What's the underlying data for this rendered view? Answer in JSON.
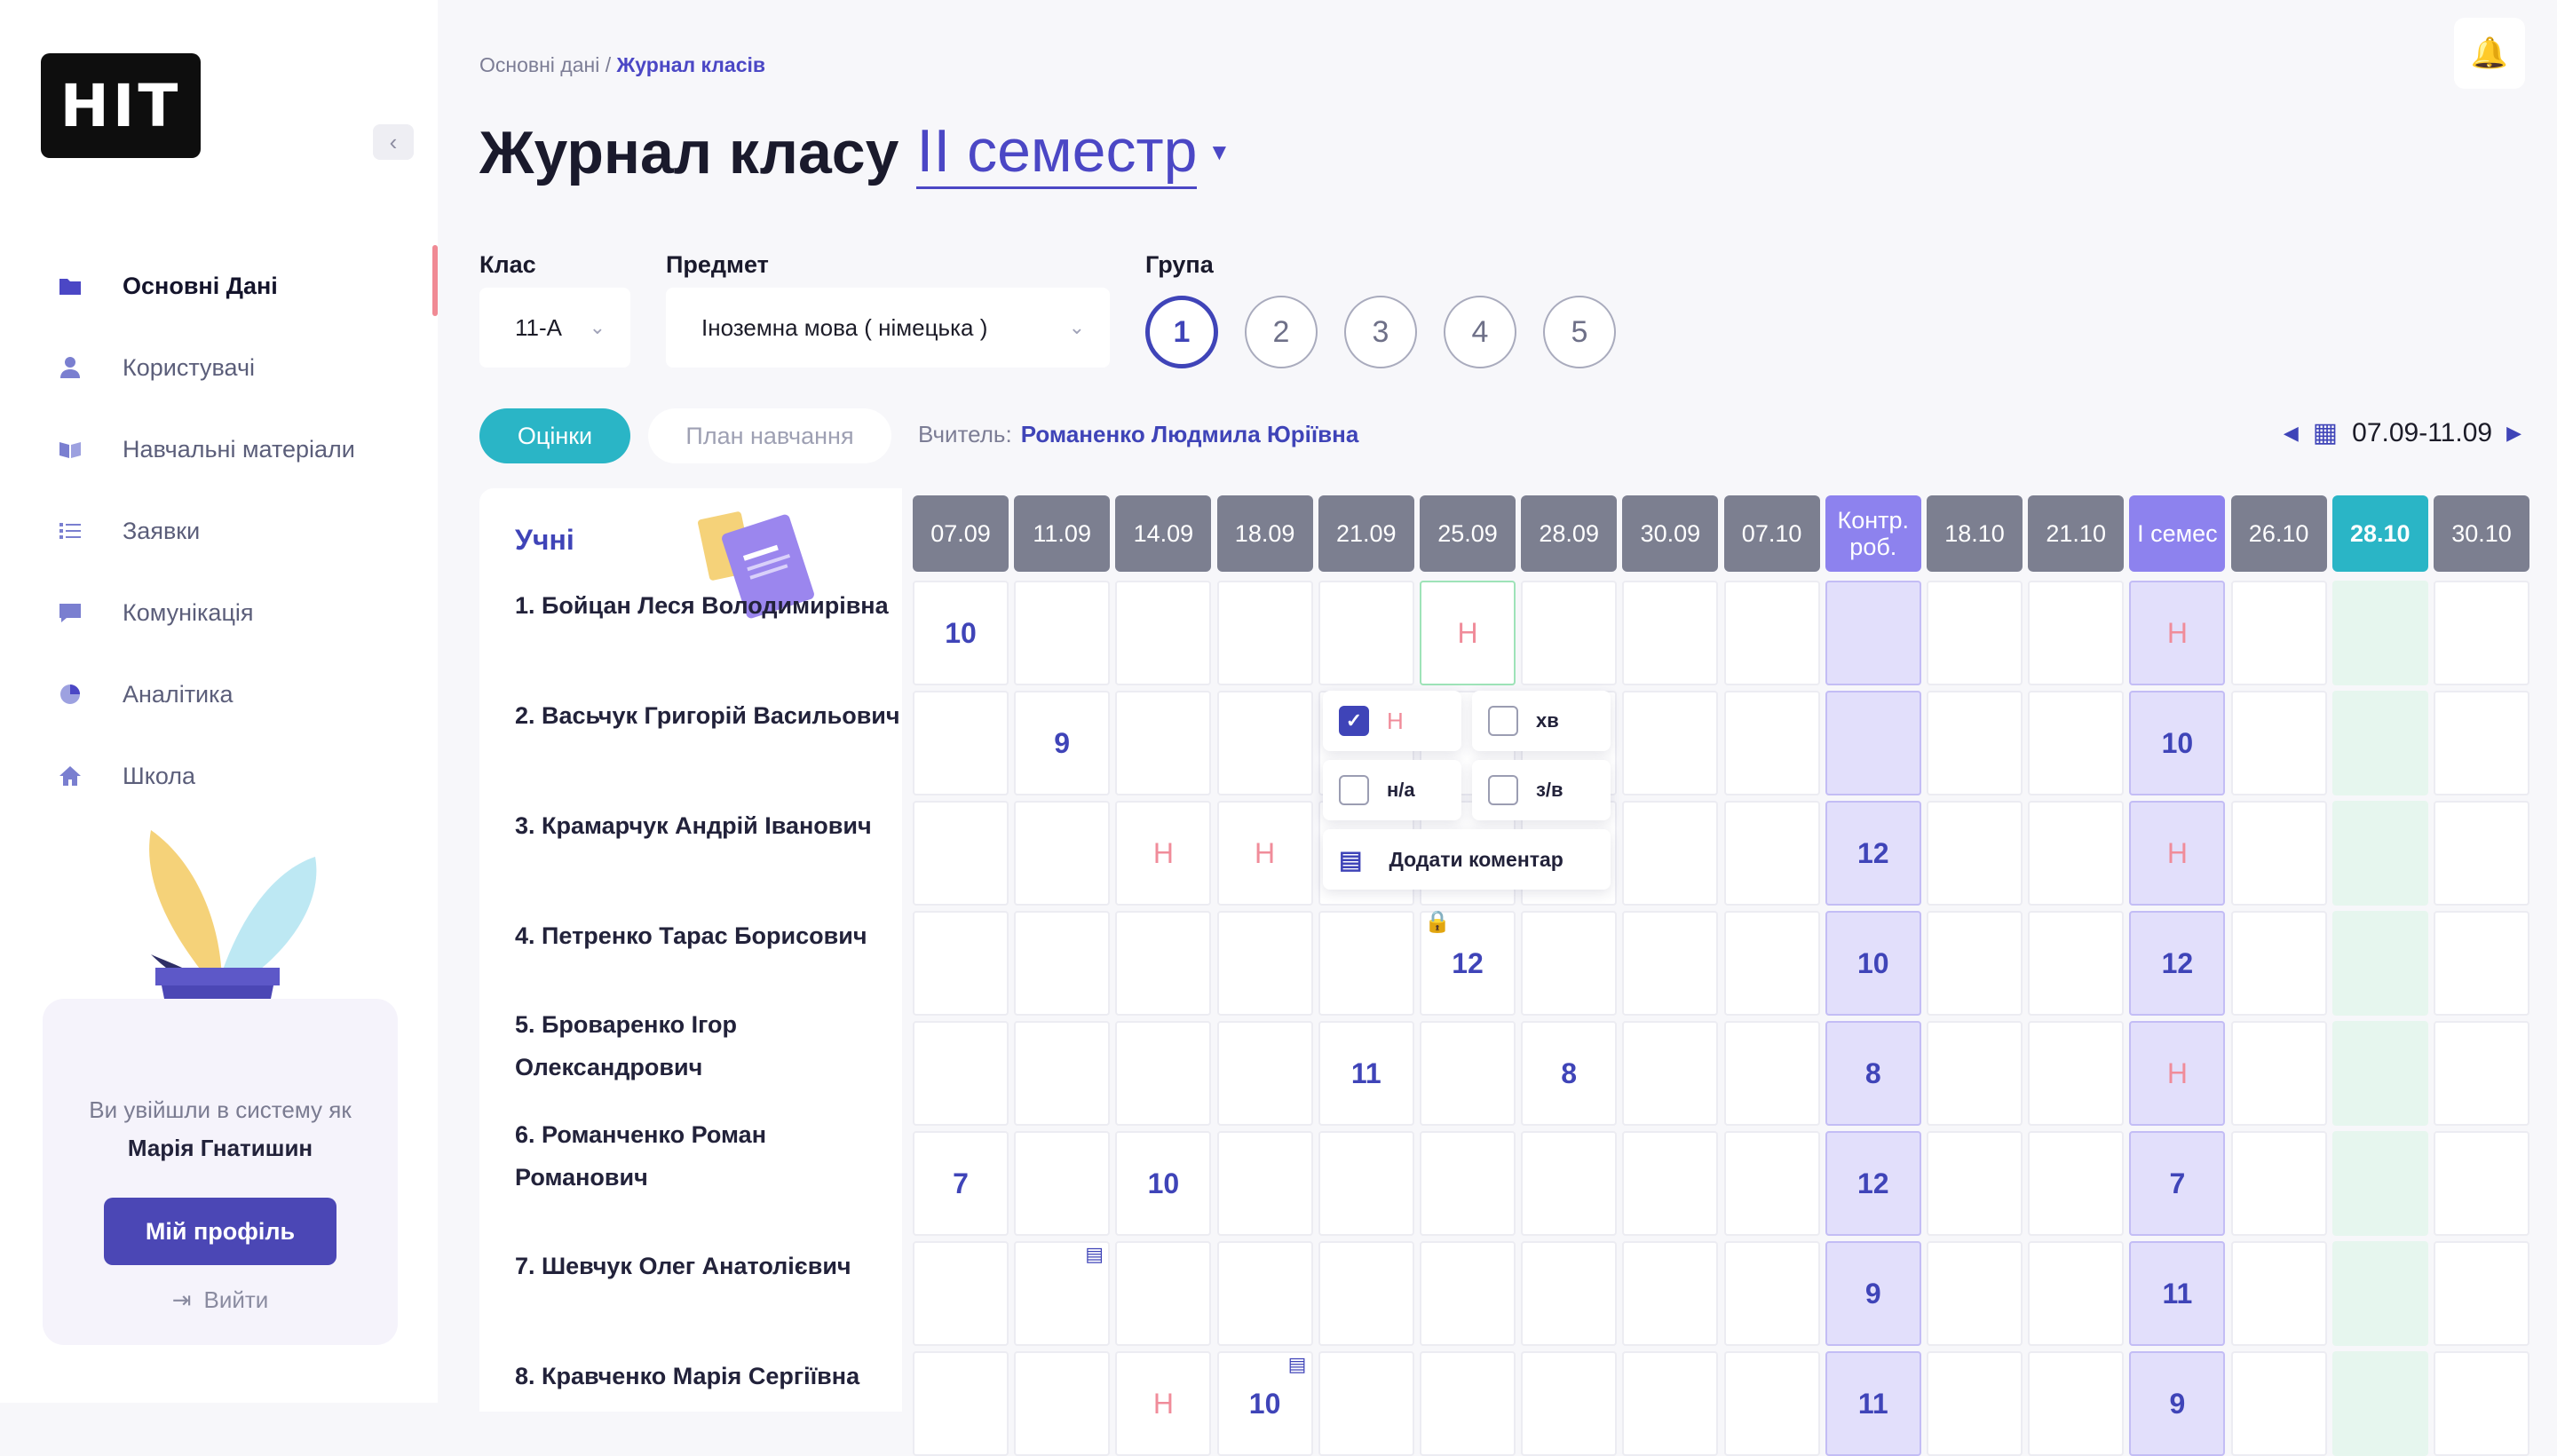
{
  "app": {
    "logo_text": "НІТ"
  },
  "sidebar": {
    "collapse_icon": "chevron-left-icon",
    "items": [
      {
        "label": "Основні Дані",
        "icon": "folder-icon",
        "active": true
      },
      {
        "label": "Користувачі",
        "icon": "user-icon"
      },
      {
        "label": "Навчальні матеріали",
        "icon": "book-icon"
      },
      {
        "label": "Заявки",
        "icon": "list-icon"
      },
      {
        "label": "Комунікація",
        "icon": "chat-icon"
      },
      {
        "label": "Аналітика",
        "icon": "chart-pie-icon"
      },
      {
        "label": "Школа",
        "icon": "home-icon"
      }
    ],
    "login_text": "Ви увійшли в систему як",
    "user_name": "Марія Гнатишин",
    "profile_button": "Мій профіль",
    "logout_label": "Вийти"
  },
  "header": {
    "breadcrumb_parent": "Основні дані /",
    "breadcrumb_current": "Журнал класів",
    "title": "Журнал класу",
    "semester": "II семестр",
    "bell_icon": "bell-icon"
  },
  "filters": {
    "class_label": "Клас",
    "class_value": "11-А",
    "subject_label": "Предмет",
    "subject_value": "Іноземна мова ( німецька )",
    "group_label": "Група",
    "groups": [
      "1",
      "2",
      "3",
      "4",
      "5"
    ],
    "active_group": "1"
  },
  "tabs": {
    "grades": "Оцінки",
    "plan": "План навчання"
  },
  "teacher": {
    "label": "Вчитель:",
    "name": "Романенко Людмила Юріївна"
  },
  "date_range": "07.09-11.09",
  "journal": {
    "students_title": "Учні",
    "dates": [
      "07.09",
      "11.09",
      "14.09",
      "18.09",
      "21.09",
      "25.09",
      "28.09",
      "30.09",
      "07.10",
      "Контр. роб.",
      "18.10",
      "21.10",
      "I семес",
      "26.10",
      "28.10",
      "30.10"
    ],
    "students": [
      "1. Бойцан Леся Володимирівна",
      "2. Васьчук Григорій Васильович",
      "3. Крамарчук Андрій Іванович",
      "4. Петренко Тарас Борисович",
      "5. Броваренко Ігор Олександрович",
      "6. Романченко Роман Романович",
      "7. Шевчук Олег Анатолієвич",
      "8. Кравченко Марія Сергіївна"
    ],
    "grades": [
      [
        "10",
        "",
        "",
        "",
        "",
        "Н",
        "",
        "",
        "",
        "",
        "",
        "",
        "Н",
        "",
        "",
        ""
      ],
      [
        "",
        "9",
        "",
        "",
        "",
        "",
        "",
        "",
        "",
        "",
        "",
        "",
        "10",
        "",
        "",
        ""
      ],
      [
        "",
        "",
        "Н",
        "Н",
        "",
        "",
        "",
        "",
        "",
        "12",
        "",
        "",
        "Н",
        "",
        "",
        ""
      ],
      [
        "",
        "",
        "",
        "",
        "",
        "12",
        "",
        "",
        "",
        "10",
        "",
        "",
        "12",
        "",
        "",
        ""
      ],
      [
        "",
        "",
        "",
        "",
        "11",
        "",
        "8",
        "",
        "",
        "8",
        "",
        "",
        "Н",
        "",
        "",
        ""
      ],
      [
        "7",
        "",
        "10",
        "",
        "",
        "",
        "",
        "",
        "",
        "12",
        "",
        "",
        "7",
        "",
        "",
        ""
      ],
      [
        "",
        "",
        "",
        "",
        "",
        "",
        "",
        "",
        "",
        "9",
        "",
        "",
        "11",
        "",
        "",
        ""
      ],
      [
        "",
        "",
        "Н",
        "10",
        "",
        "",
        "",
        "",
        "",
        "11",
        "",
        "",
        "9",
        "",
        "",
        ""
      ]
    ]
  },
  "popover": {
    "options": [
      {
        "label": "Н",
        "checked": true
      },
      {
        "label": "хв",
        "checked": false
      },
      {
        "label": "н/а",
        "checked": false
      },
      {
        "label": "з/в",
        "checked": false
      }
    ],
    "comment_label": "Додати коментар"
  }
}
